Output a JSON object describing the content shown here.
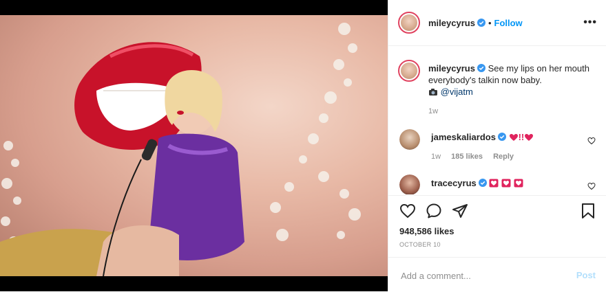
{
  "header": {
    "username": "mileycyrus",
    "separator": "•",
    "follow_label": "Follow",
    "more_icon": "more-horizontal-icon",
    "more_glyph": "•••"
  },
  "caption": {
    "username": "mileycyrus",
    "text": "See my lips on her mouth everybody's talkin now baby.",
    "camera_icon": "camera-emoji",
    "mention": "@vijatm",
    "time": "1w"
  },
  "comments": [
    {
      "username": "jameskaliardos",
      "text": "!!",
      "time": "1w",
      "likes": "185 likes",
      "reply_label": "Reply"
    },
    {
      "username": "tracecyrus",
      "text": ""
    }
  ],
  "actions": {
    "likes": "948,586 likes",
    "date": "OCTOBER 10"
  },
  "add_comment": {
    "placeholder": "Add a comment...",
    "post_label": "Post"
  },
  "colors": {
    "accent": "#0095f6",
    "text": "#262626",
    "muted": "#8e8e8e",
    "post_disabled": "#b2dffc",
    "heart_red": "#e0245e"
  }
}
